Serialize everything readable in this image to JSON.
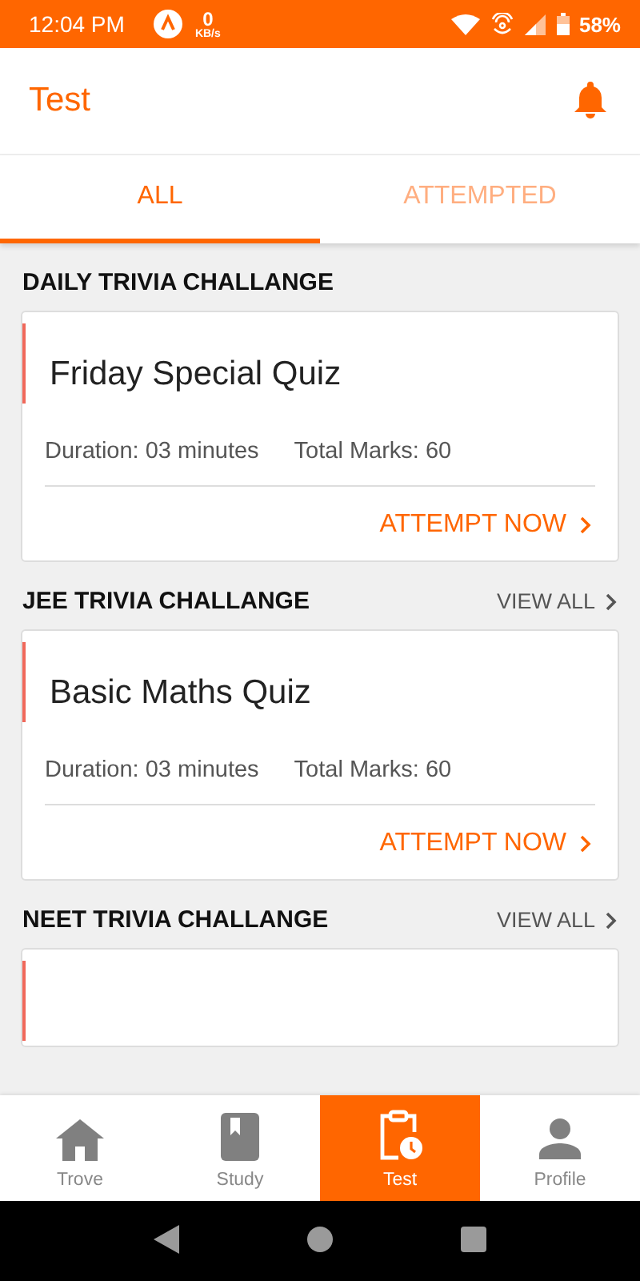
{
  "status_bar": {
    "time": "12:04 PM",
    "speed": "0",
    "speed_unit": "KB/s",
    "battery": "58%"
  },
  "header": {
    "title": "Test"
  },
  "tabs": [
    {
      "label": "ALL",
      "selected": true
    },
    {
      "label": "ATTEMPTED",
      "selected": false
    }
  ],
  "sections": [
    {
      "title": "DAILY TRIVIA CHALLANGE",
      "cards": [
        {
          "kind": "full",
          "title": "Friday Special Quiz",
          "duration": "Duration: 03 minutes",
          "marks": "Total Marks: 60",
          "action": "ATTEMPT NOW"
        }
      ]
    },
    {
      "title": "JEE TRIVIA CHALLANGE",
      "view_all": "VIEW ALL",
      "cards": [
        {
          "kind": "full",
          "title": "Basic Maths Quiz",
          "duration": "Duration: 03 minutes",
          "marks": "Total Marks: 60",
          "action": "ATTEMPT NOW"
        }
      ]
    },
    {
      "title": "NEET TRIVIA CHALLANGE",
      "view_all": "VIEW ALL",
      "cards": [
        {
          "kind": "cut"
        }
      ]
    }
  ],
  "bottom_nav": [
    {
      "label": "Trove",
      "selected": false
    },
    {
      "label": "Study",
      "selected": false
    },
    {
      "label": "Test",
      "selected": true
    },
    {
      "label": "Profile",
      "selected": false
    }
  ]
}
